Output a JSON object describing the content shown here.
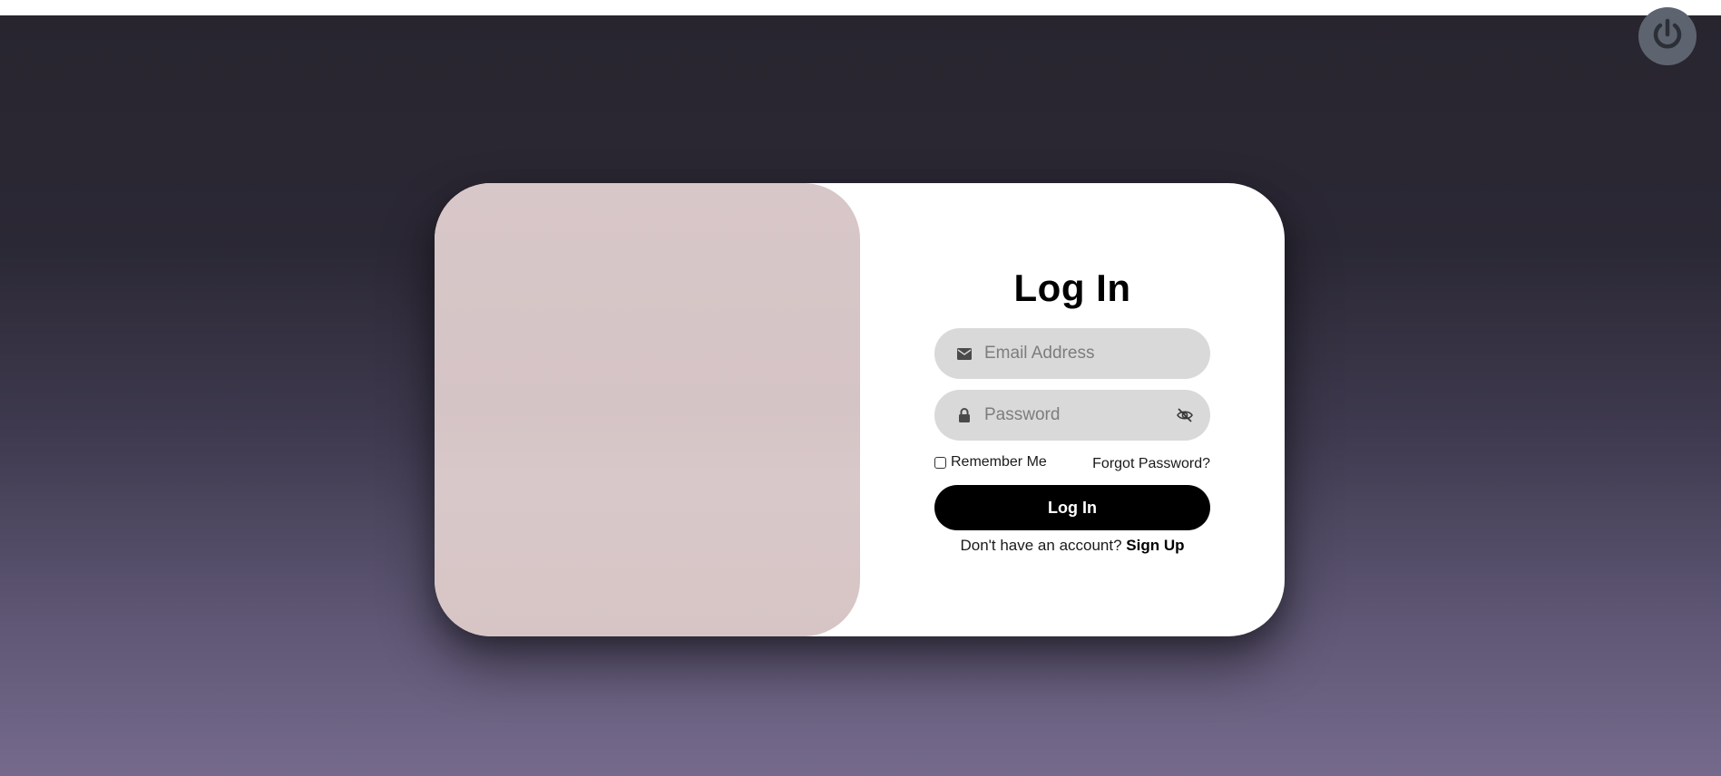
{
  "login": {
    "title": "Log In",
    "email_placeholder": "Email Address",
    "password_placeholder": "Password",
    "remember_label": "Remember Me",
    "forgot_label": "Forgot Password?",
    "submit_label": "Log In",
    "signup_prompt": "Don't have an account?",
    "signup_label": "Sign Up"
  },
  "icons": {
    "power": "power-icon",
    "email": "envelope-icon",
    "password": "lock-icon",
    "toggle": "eye-slash-icon"
  },
  "colors": {
    "background_top": "#28252f",
    "background_bottom": "#756a8c",
    "card": "#ffffff",
    "image_panel": "#d8c7c8",
    "input_fill": "#d9d9d9",
    "button": "#000000",
    "power_button": "#5d6470"
  }
}
